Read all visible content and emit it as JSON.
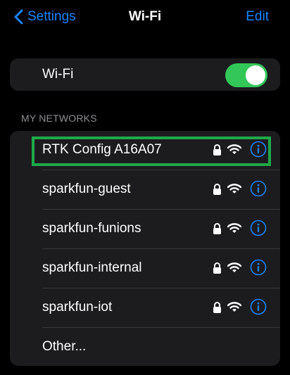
{
  "nav": {
    "back_label": "Settings",
    "title": "Wi-Fi",
    "edit_label": "Edit"
  },
  "wifi": {
    "label": "Wi-Fi",
    "enabled": true
  },
  "section_header": "MY NETWORKS",
  "networks": [
    {
      "name": "RTK Config A16A07",
      "locked": true,
      "selected_highlight": true
    },
    {
      "name": "sparkfun-guest",
      "locked": true
    },
    {
      "name": "sparkfun-funions",
      "locked": true
    },
    {
      "name": "sparkfun-internal",
      "locked": true
    },
    {
      "name": "sparkfun-iot",
      "locked": true
    }
  ],
  "other_label": "Other...",
  "icons": {
    "back": "chevron-left-icon",
    "lock": "lock-icon",
    "wifi": "wifi-signal-icon",
    "info": "info-icon"
  },
  "colors": {
    "accent": "#1b84ff",
    "toggle_on": "#33c759",
    "highlight": "#1fa94a",
    "card_bg": "#1c1c1e",
    "secondary_text": "#8e8e93"
  }
}
